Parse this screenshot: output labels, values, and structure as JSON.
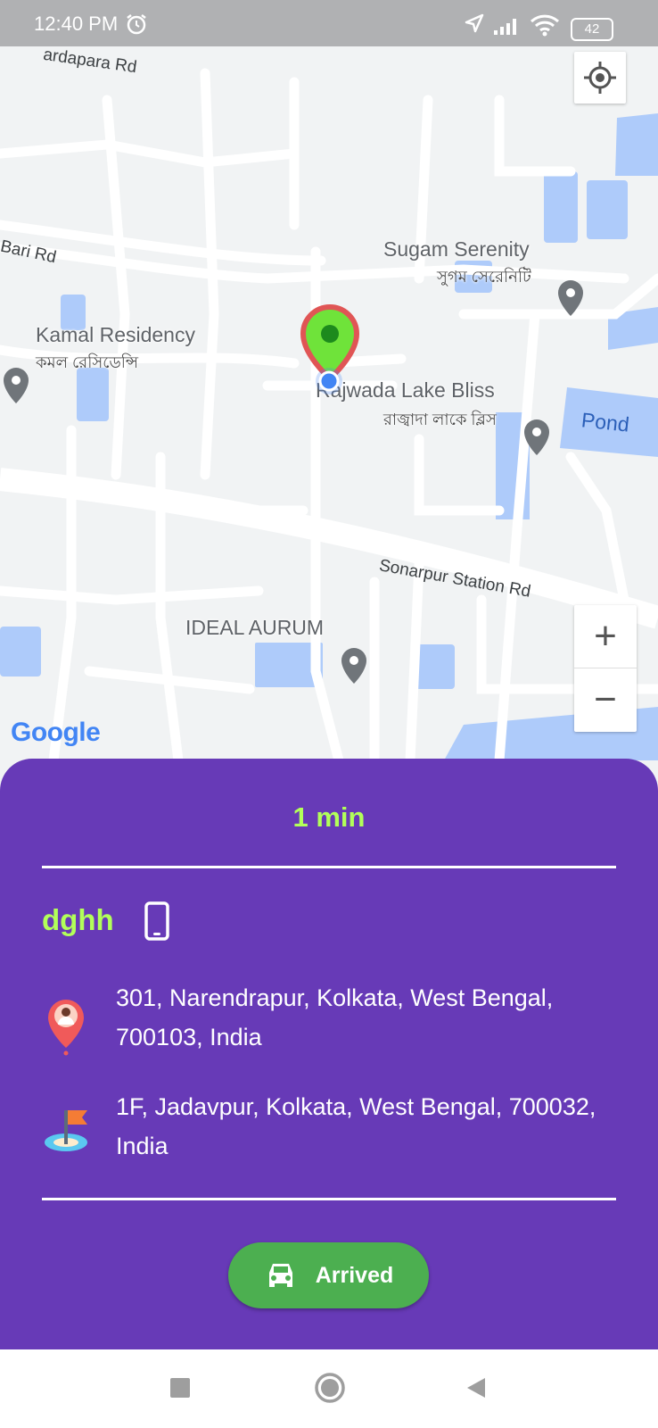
{
  "status_bar": {
    "time": "12:40 PM",
    "battery": "42",
    "icons": [
      "alarm-icon",
      "location-arrow-icon",
      "signal-icon",
      "wifi-icon",
      "battery-icon"
    ]
  },
  "map": {
    "roads": [
      "Bari Rd",
      "Sonarpur Station Rd",
      "ardapara Rd"
    ],
    "places": [
      {
        "name": "Sugam Serenity",
        "local": "সুগম সেরেনিটি"
      },
      {
        "name": "Kamal Residency",
        "local": "কমল রেসিডেন্সি"
      },
      {
        "name": "Rajwada Lake Bliss",
        "local": "রাজ্বাদা লাকে ব্লিস"
      },
      {
        "name": "IDEAL AURUM",
        "local": ""
      }
    ],
    "water": [
      "Pond"
    ],
    "zoom_in": "+",
    "zoom_out": "−",
    "attribution": "Google"
  },
  "sheet": {
    "eta": "1 min",
    "customer_name": "dghh",
    "pickup_address": "301, Narendrapur, Kolkata, West Bengal, 700103, India",
    "drop_address": "1F, Jadavpur, Kolkata, West Bengal, 700032, India",
    "arrived_label": "Arrived"
  },
  "colors": {
    "sheet_bg": "#673ab7",
    "accent": "#b2ff59",
    "button": "#4caf50",
    "marker": "#6fe33a"
  }
}
